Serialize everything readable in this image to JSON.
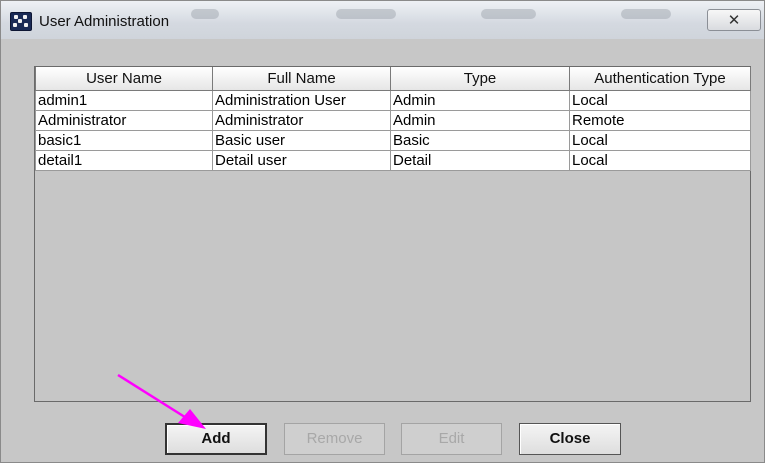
{
  "window": {
    "title": "User Administration",
    "close_glyph": "✕"
  },
  "table": {
    "columns": [
      "User Name",
      "Full Name",
      "Type",
      "Authentication Type"
    ],
    "rows": [
      [
        "admin1",
        "Administration User",
        "Admin",
        "Local"
      ],
      [
        "Administrator",
        "Administrator",
        "Admin",
        "Remote"
      ],
      [
        "basic1",
        "Basic user",
        "Basic",
        "Local"
      ],
      [
        "detail1",
        "Detail user",
        "Detail",
        "Local"
      ]
    ]
  },
  "buttons": {
    "add": "Add",
    "remove": "Remove",
    "edit": "Edit",
    "close": "Close"
  },
  "annotation": {
    "arrow_color": "#ff00ff"
  }
}
